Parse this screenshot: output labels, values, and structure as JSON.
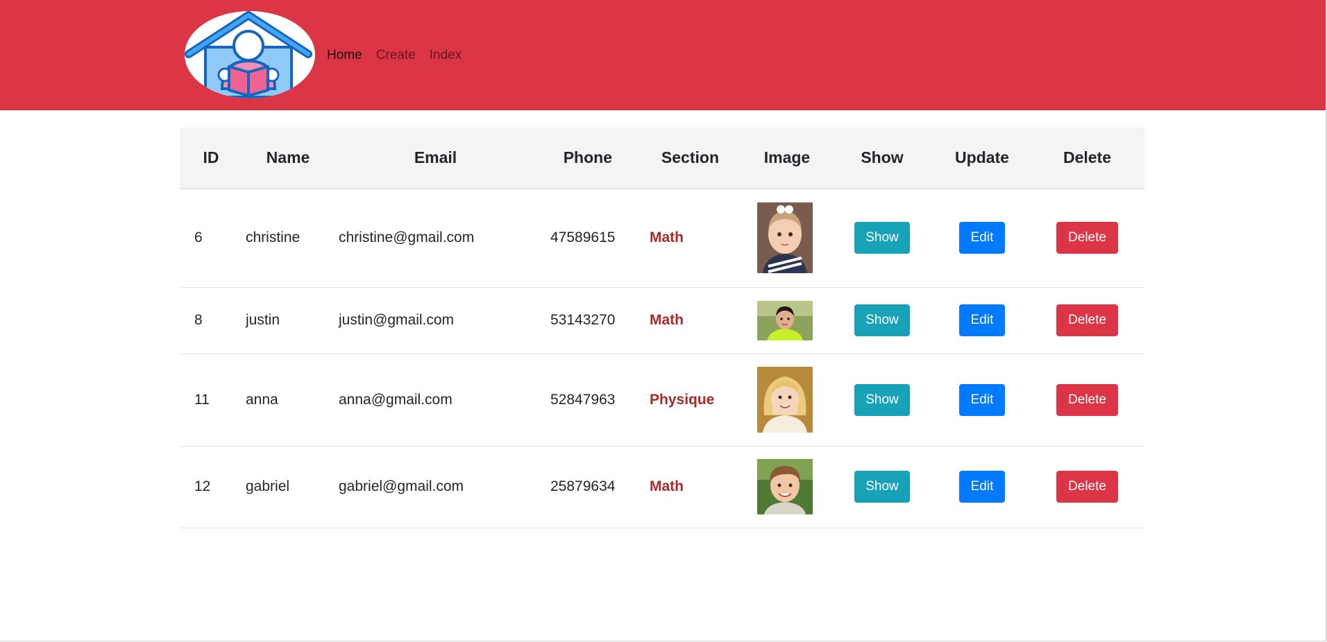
{
  "colors": {
    "navbar_bg": "#dc3545",
    "show_button": "#17a2b8",
    "edit_button": "#007bff",
    "delete_button": "#dc3545",
    "section_text": "#a52a2a",
    "header_row_bg": "#f4f4f4"
  },
  "logo": {
    "icon": "house-reading-person-icon"
  },
  "nav": {
    "items": [
      {
        "label": "Home"
      },
      {
        "label": "Create"
      },
      {
        "label": "Index"
      }
    ]
  },
  "table": {
    "headers": [
      "ID",
      "Name",
      "Email",
      "Phone",
      "Section",
      "Image",
      "Show",
      "Update",
      "Delete"
    ],
    "rows": [
      {
        "id": "6",
        "name": "christine",
        "email": "christine@gmail.com",
        "phone": "47589615",
        "section": "Math",
        "image": "child-photo-girl-white-bow",
        "show_label": "Show",
        "edit_label": "Edit",
        "delete_label": "Delete"
      },
      {
        "id": "8",
        "name": "justin",
        "email": "justin@gmail.com",
        "phone": "53143270",
        "section": "Math",
        "image": "child-photo-boy-green-shirt",
        "show_label": "Show",
        "edit_label": "Edit",
        "delete_label": "Delete"
      },
      {
        "id": "11",
        "name": "anna",
        "email": "anna@gmail.com",
        "phone": "52847963",
        "section": "Physique",
        "image": "child-photo-girl-blonde",
        "show_label": "Show",
        "edit_label": "Edit",
        "delete_label": "Delete"
      },
      {
        "id": "12",
        "name": "gabriel",
        "email": "gabriel@gmail.com",
        "phone": "25879634",
        "section": "Math",
        "image": "child-photo-boy-smiling",
        "show_label": "Show",
        "edit_label": "Edit",
        "delete_label": "Delete"
      }
    ]
  }
}
